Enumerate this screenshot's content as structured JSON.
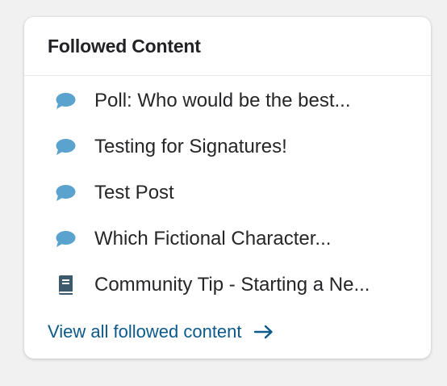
{
  "widget": {
    "title": "Followed Content",
    "items": [
      {
        "label": "Poll: Who would be the best...",
        "icon": "chat-bubble-icon"
      },
      {
        "label": "Testing for Signatures!",
        "icon": "chat-bubble-icon"
      },
      {
        "label": "Test Post",
        "icon": "chat-bubble-icon"
      },
      {
        "label": "Which Fictional Character...",
        "icon": "chat-bubble-icon"
      },
      {
        "label": "Community Tip - Starting a Ne...",
        "icon": "book-icon"
      }
    ],
    "view_all_label": "View all followed content",
    "view_all_icon": "arrow-right-icon"
  },
  "colors": {
    "background": "#f1f1f2",
    "card": "#ffffff",
    "chat_icon": "#5aa3cf",
    "book_icon": "#3d5a6c",
    "link": "#0b5a8a",
    "text": "#262629"
  }
}
